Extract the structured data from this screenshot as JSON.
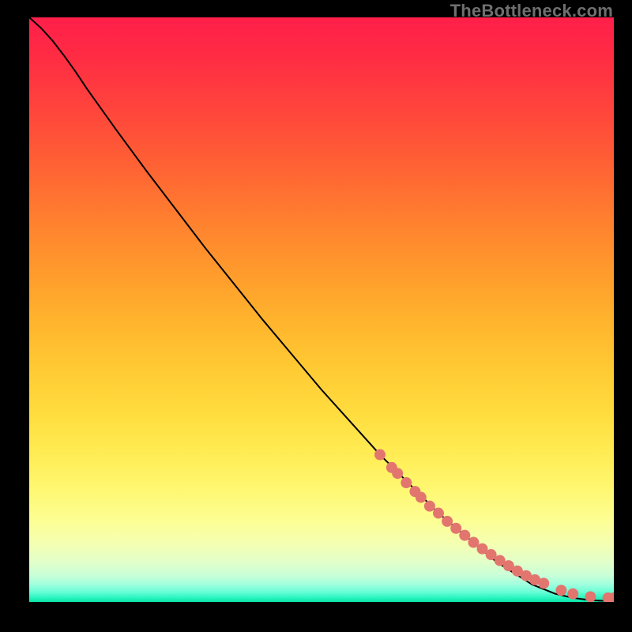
{
  "watermark": "TheBottleneck.com",
  "chart_data": {
    "type": "line",
    "title": "",
    "xlabel": "",
    "ylabel": "",
    "xlim": [
      0,
      100
    ],
    "ylim": [
      0,
      100
    ],
    "grid": false,
    "legend": false,
    "series": [
      {
        "name": "curve",
        "kind": "line",
        "color": "#000000",
        "x": [
          0,
          2,
          4,
          6,
          8,
          10,
          15,
          20,
          30,
          40,
          50,
          60,
          70,
          80,
          86,
          90,
          93,
          96,
          98,
          100
        ],
        "y": [
          100,
          98.2,
          96.0,
          93.4,
          90.6,
          87.6,
          80.6,
          73.8,
          60.7,
          48.2,
          36.3,
          25.2,
          15.2,
          6.8,
          3.0,
          1.4,
          0.7,
          0.3,
          0.2,
          0.2
        ]
      },
      {
        "name": "markers",
        "kind": "scatter",
        "color": "#e2766f",
        "x": [
          60,
          62,
          63,
          64.5,
          66,
          67,
          68.5,
          70,
          71.5,
          73,
          74.5,
          76,
          77.5,
          79,
          80.5,
          82,
          83.5,
          85,
          86.5,
          88,
          91,
          93,
          96,
          99,
          100
        ],
        "y": [
          25.2,
          23.0,
          22.0,
          20.4,
          18.9,
          17.9,
          16.4,
          15.2,
          13.8,
          12.6,
          11.4,
          10.2,
          9.1,
          8.1,
          7.1,
          6.2,
          5.3,
          4.5,
          3.8,
          3.2,
          2.0,
          1.4,
          0.9,
          0.7,
          0.7
        ]
      }
    ]
  }
}
